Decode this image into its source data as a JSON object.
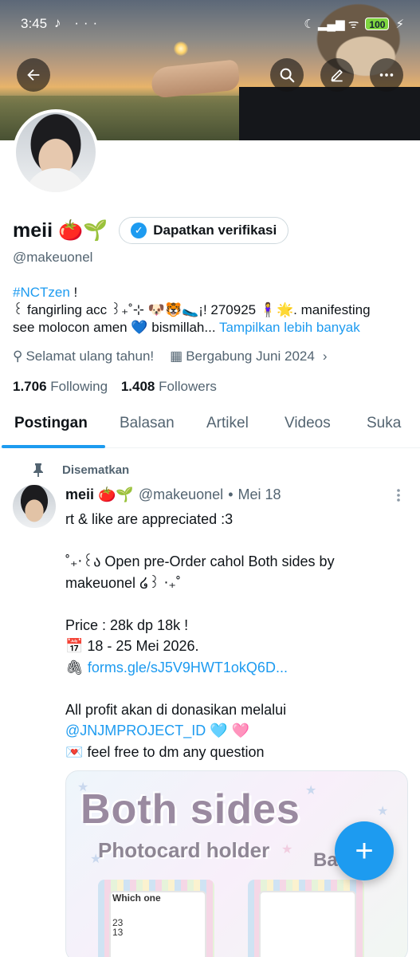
{
  "status_bar": {
    "time": "3:45",
    "left_icons": "♪ ···",
    "battery": "100",
    "right_icons": "☾ ▂▄▆ ᯤ"
  },
  "header": {
    "back_icon": "arrow-left-icon",
    "search_icon": "search-icon",
    "edit_icon": "edit-icon",
    "more_icon": "more-icon"
  },
  "profile": {
    "name": "meii 🍅🌱",
    "verify_label": "Dapatkan verifikasi",
    "handle": "@makeuonel",
    "bio_hashtag": "#NCTzen",
    "bio_exclaim": " !",
    "bio_line2": "꒰ fangirling acc ꒱₊˚⊹ 🐶🐯🥿¡! 270925 🧍‍♀️🌟. manifesting",
    "bio_line3": "see molocon amen 💙 bismillah...",
    "bio_more": " Tampilkan lebih banyak",
    "birthday": "Selamat ulang tahun!",
    "joined": "Bergabung Juni 2024",
    "following_count": "1.706",
    "following_label": "Following",
    "followers_count": "1.408",
    "followers_label": "Followers"
  },
  "tabs": [
    "Postingan",
    "Balasan",
    "Artikel",
    "Videos",
    "Suka"
  ],
  "pinned_label": "Disematkan",
  "post": {
    "name": "meii 🍅🌱",
    "handle": "@makeuonel",
    "dot": "•",
    "date": "Mei 18",
    "line1": "rt & like are appreciated :3",
    "line2": "˚₊‧꒰ა Open pre-Order cahol Both sides by",
    "line3": "makeuonel ໒꒱ ‧₊˚",
    "line4": "Price : 28k dp 18k !",
    "line5": "📅 18 - 25 Mei 2026.",
    "line6_icon": "🖇",
    "line6_link": "forms.gle/sJ5V9HWT1okQ6D...",
    "line7": "All profit akan di donasikan melalui",
    "line8_link": "@JNJMPROJECT_ID",
    "line8_emoji": " 🩵 🩷",
    "line9": "💌 feel free to dm any question"
  },
  "media": {
    "title": "Both sides",
    "subtitle": "Photocard holder",
    "corner": "Ba",
    "which_one": "Which one",
    "nums": "23\n13"
  },
  "fab_label": "+"
}
